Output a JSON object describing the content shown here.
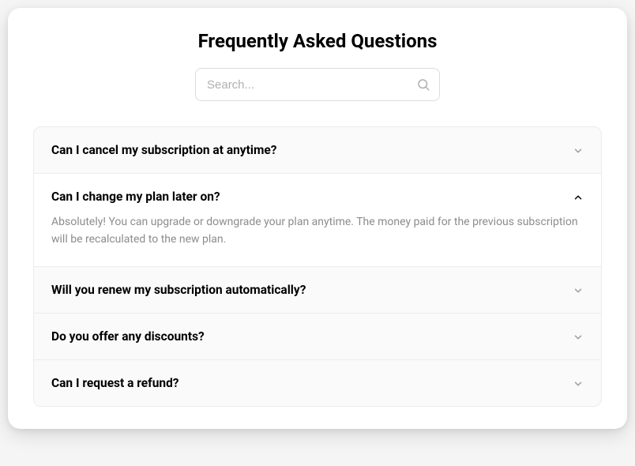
{
  "title": "Frequently Asked Questions",
  "search": {
    "placeholder": "Search..."
  },
  "faq": [
    {
      "question": "Can I cancel my subscription at anytime?",
      "expanded": false
    },
    {
      "question": "Can I change my plan later on?",
      "answer": "Absolutely! You can upgrade or downgrade your plan anytime. The money paid for the previous subscription will be recalculated to the new plan.",
      "expanded": true
    },
    {
      "question": "Will you renew my subscription automatically?",
      "expanded": false
    },
    {
      "question": "Do you offer any discounts?",
      "expanded": false
    },
    {
      "question": "Can I request a refund?",
      "expanded": false
    }
  ]
}
